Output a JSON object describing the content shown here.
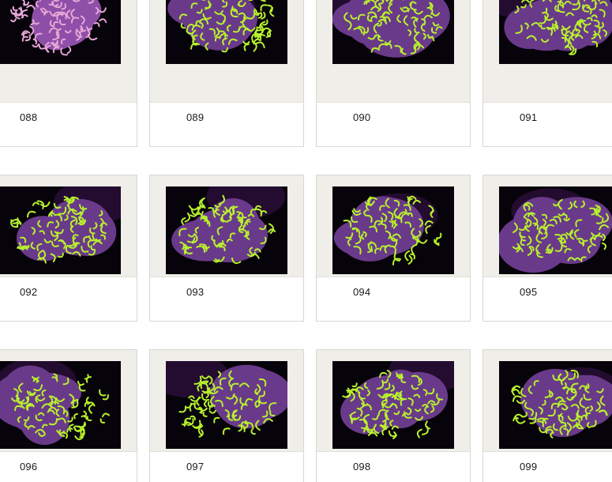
{
  "gallery": {
    "items": [
      {
        "label": "088",
        "style": "pink"
      },
      {
        "label": "089",
        "style": "green"
      },
      {
        "label": "090",
        "style": "green"
      },
      {
        "label": "091",
        "style": "green"
      },
      {
        "label": "092",
        "style": "green"
      },
      {
        "label": "093",
        "style": "green"
      },
      {
        "label": "094",
        "style": "green"
      },
      {
        "label": "095",
        "style": "green"
      },
      {
        "label": "096",
        "style": "green"
      },
      {
        "label": "097",
        "style": "green"
      },
      {
        "label": "098",
        "style": "green"
      },
      {
        "label": "099",
        "style": "green"
      }
    ]
  },
  "colors": {
    "mat": "#efeee9",
    "photo_bg": "#07030a",
    "coral_green": "#b8f22c",
    "coral_purple": "#6a3a8a",
    "coral_pink": "#e7a6d8",
    "coral_pink_shadow": "#8e4fa8",
    "label_text": "#1a1a1a"
  }
}
